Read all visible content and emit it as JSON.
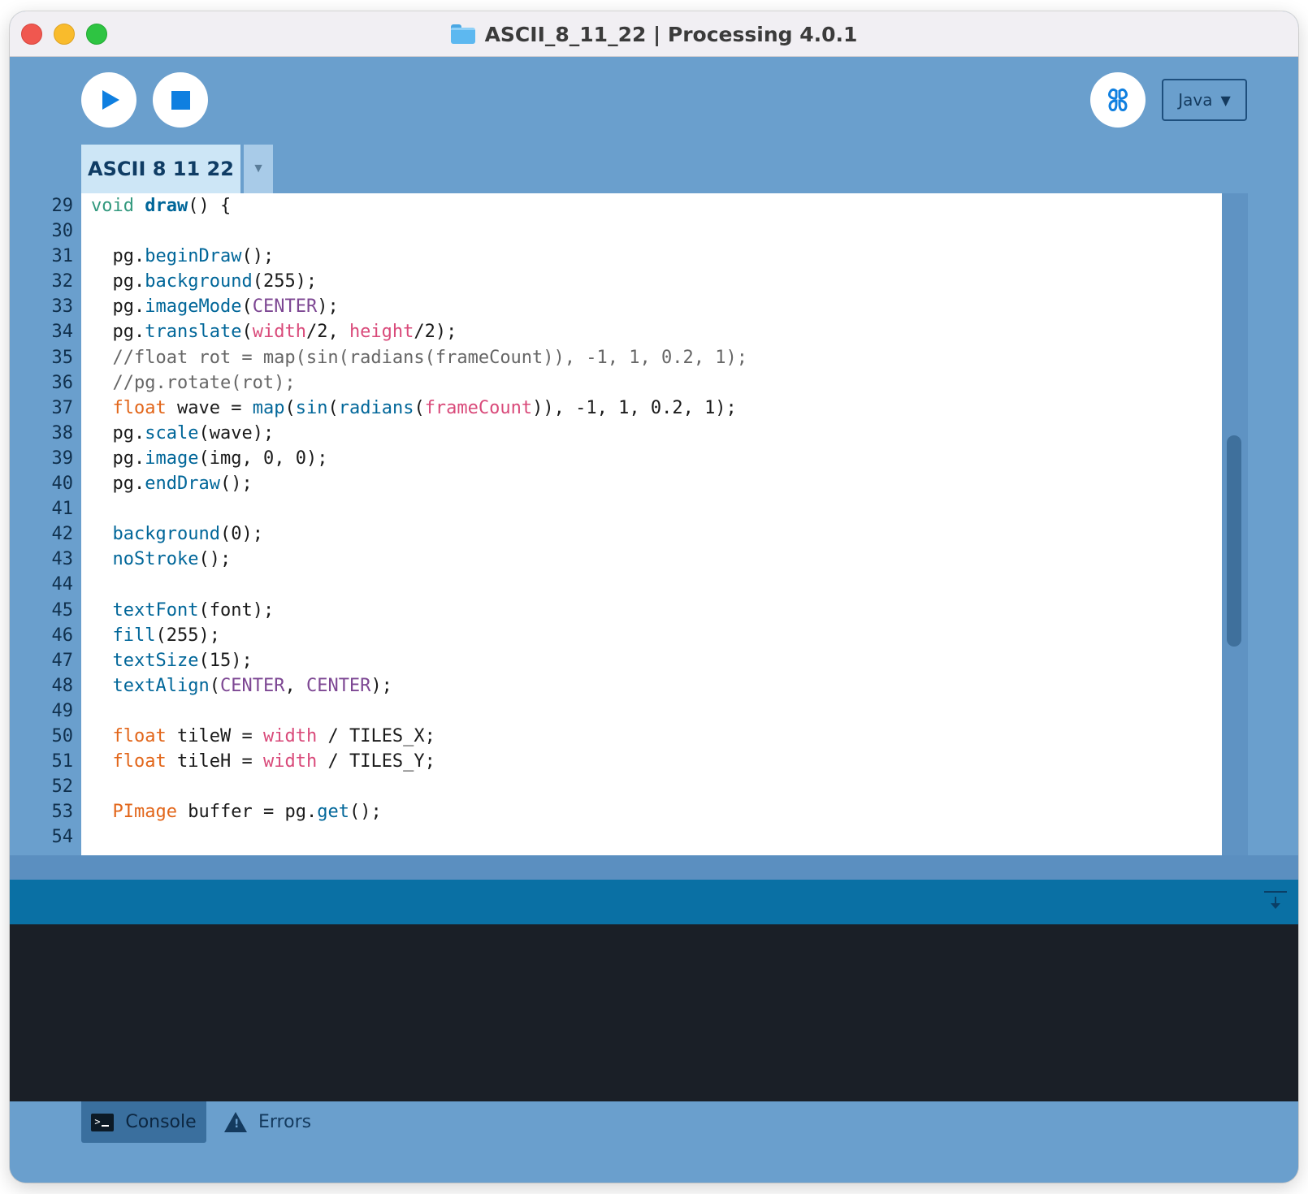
{
  "window": {
    "title": "ASCII_8_11_22 | Processing 4.0.1"
  },
  "toolbar": {
    "mode_label": "Java",
    "mode_arrow": "▼",
    "icons": [
      "play-icon",
      "stop-icon",
      "debugger-butterfly-icon"
    ]
  },
  "tabs": {
    "sketch_label": "ASCII 8 11 22",
    "menu_arrow": "▼"
  },
  "editor": {
    "line_numbers": [
      "29",
      "30",
      "31",
      "32",
      "33",
      "34",
      "35",
      "36",
      "37",
      "38",
      "39",
      "40",
      "41",
      "42",
      "43",
      "44",
      "45",
      "46",
      "47",
      "48",
      "49",
      "50",
      "51",
      "52",
      "53",
      "54"
    ],
    "code_lines": [
      "void draw() {",
      "",
      "  pg.beginDraw();",
      "  pg.background(255);",
      "  pg.imageMode(CENTER);",
      "  pg.translate(width/2, height/2);",
      "  //float rot = map(sin(radians(frameCount)), -1, 1, 0.2, 1);",
      "  //pg.rotate(rot);",
      "  float wave = map(sin(radians(frameCount)), -1, 1, 0.2, 1);",
      "  pg.scale(wave);",
      "  pg.image(img, 0, 0);",
      "  pg.endDraw();",
      "",
      "  background(0);",
      "  noStroke();",
      "",
      "  textFont(font);",
      "  fill(255);",
      "  textSize(15);",
      "  textAlign(CENTER, CENTER);",
      "",
      "  float tileW = width / TILES_X;",
      "  float tileH = width / TILES_Y;",
      "",
      "  PImage buffer = pg.get();",
      ""
    ]
  },
  "footer": {
    "console_label": "Console",
    "errors_label": "Errors"
  },
  "colors": {
    "window_blue": "#6a9fcd",
    "divider_blue": "#0a70a4",
    "console_bg": "#1a1f27",
    "keyword_void": "#33997e",
    "function": "#006699",
    "constant": "#7d4793",
    "variable": "#d94a7a",
    "type": "#e2661a",
    "comment": "#666666"
  }
}
